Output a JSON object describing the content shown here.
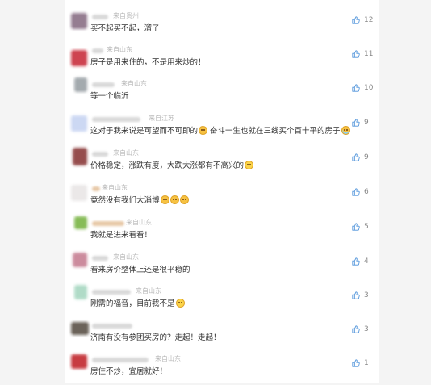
{
  "comments": [
    {
      "location": "来自贵州",
      "text": "买不起买不起，溜了",
      "emoji": "",
      "likes": "12",
      "avatar_color": "#8a6f86"
    },
    {
      "location": "来自山东",
      "text": "房子是用来住的，不是用来炒的！",
      "emoji": "",
      "likes": "11",
      "avatar_color": "#c9303f"
    },
    {
      "location": "来自山东",
      "text": "等一个临沂",
      "emoji": "",
      "likes": "10",
      "avatar_color": "#9aa1a6"
    },
    {
      "location": "来自江苏",
      "text": "这对于我来说是可望而不可即的",
      "emoji": "hand-emoji",
      "text2": " 奋斗一生也就在三线买个百十平的房子",
      "emoji2": "crying-emoji",
      "likes": "9",
      "avatar_color": "#c7d4f2"
    },
    {
      "location": "来自山东",
      "text": "价格稳定，涨跌有度，大跌大涨都有不高兴的",
      "emoji": "grin-emoji",
      "likes": "9",
      "avatar_color": "#8b3a3a"
    },
    {
      "location": "来自山东",
      "text": "竟然没有我们大淄博",
      "emoji": "pleading-emoji-x3",
      "likes": "6",
      "avatar_color": "#e9e6e6"
    },
    {
      "location": "来自山东",
      "text": "我就是进来看看！",
      "emoji": "",
      "likes": "5",
      "avatar_color": "#7ab545"
    },
    {
      "location": "来自山东",
      "text": "看来房价整体上还是很平稳的",
      "emoji": "",
      "likes": "4",
      "avatar_color": "#c77f93"
    },
    {
      "location": "来自山东",
      "text": "刚需的福音，目前我不是",
      "emoji": "grin-emoji",
      "likes": "3",
      "avatar_color": "#a8d8c2"
    },
    {
      "location": "",
      "text": "济南有没有参团买房的？走起！走起！",
      "emoji": "",
      "likes": "3",
      "avatar_color": "#5c5349"
    },
    {
      "location": "来自山东",
      "text": "房住不炒，宜居就好！",
      "emoji": "",
      "likes": "1",
      "avatar_color": "#c1272d"
    }
  ]
}
